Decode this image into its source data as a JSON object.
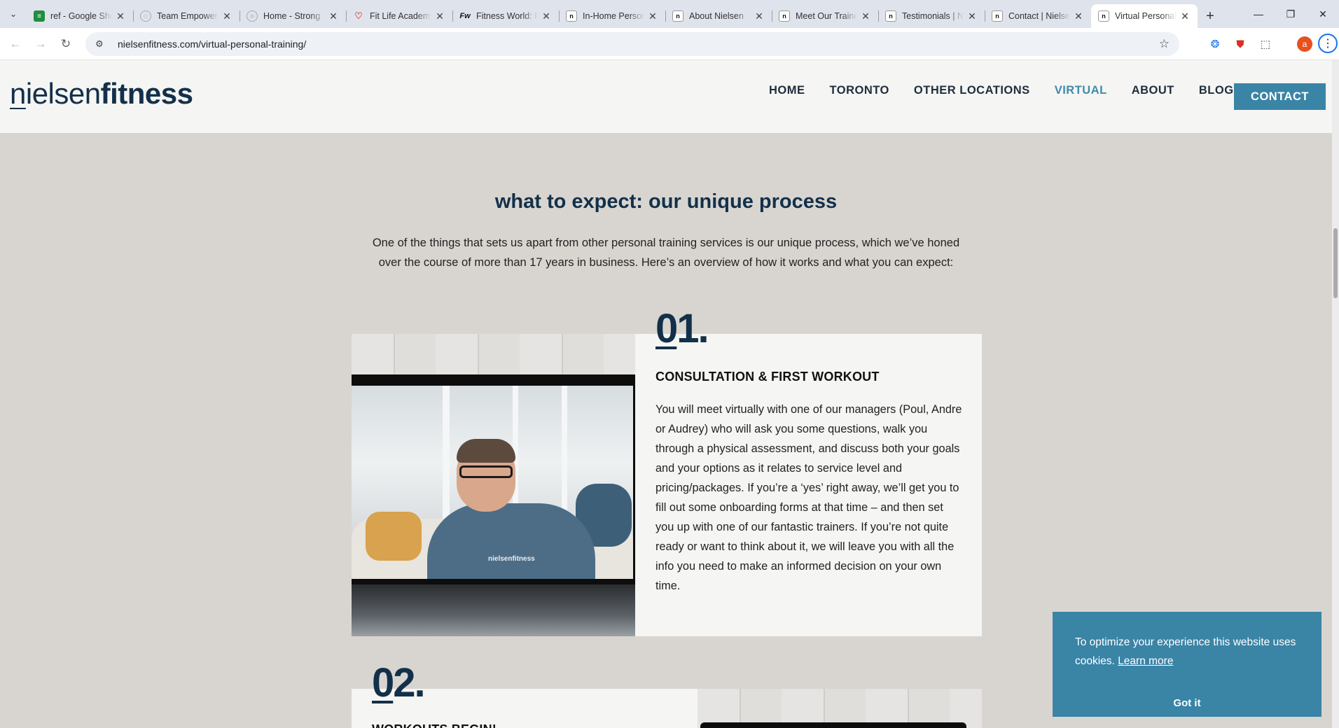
{
  "browser": {
    "tabs": [
      {
        "title": "ref - Google Sheets",
        "favicon": "sheets-icon"
      },
      {
        "title": "Team Empowerment",
        "favicon": "spiral-icon"
      },
      {
        "title": "Home - Strong",
        "favicon": "globe-icon"
      },
      {
        "title": "Fit Life Academy",
        "favicon": "heart-icon"
      },
      {
        "title": "Fitness World: Fitness",
        "favicon": "fw-icon"
      },
      {
        "title": "In-Home Personal",
        "favicon": "n-icon"
      },
      {
        "title": "About Nielsen",
        "favicon": "n-icon"
      },
      {
        "title": "Meet Our Trainers",
        "favicon": "n-icon"
      },
      {
        "title": "Testimonials | Nielsen",
        "favicon": "n-icon"
      },
      {
        "title": "Contact | Nielsen",
        "favicon": "n-icon"
      },
      {
        "title": "Virtual Personal Training",
        "favicon": "n-icon"
      }
    ],
    "active_tab_index": 10,
    "url": "nielsenfitness.com/virtual-personal-training/",
    "avatar_letter": "a"
  },
  "site": {
    "logo": {
      "part1": "n",
      "part2": "ielsen",
      "part3": "fitness"
    },
    "nav": {
      "home": "HOME",
      "toronto": "TORONTO",
      "other_locations": "OTHER LOCATIONS",
      "virtual": "VIRTUAL",
      "about": "ABOUT",
      "blog": "BLOG",
      "contact": "CONTACT"
    },
    "active_nav": "VIRTUAL",
    "accent_color": "#3a84a6",
    "brand_color": "#13304a"
  },
  "process": {
    "title": "what to expect: our unique process",
    "intro": "One of the things that sets us apart from other personal training services is our unique process, which we’ve honed over the course of more than 17 years in business. Here’s an overview of how it works and what you can expect:",
    "step1": {
      "number_a": "0",
      "number_b": "1.",
      "heading": "CONSULTATION & FIRST WORKOUT",
      "body": "You will meet virtually with one of our managers (Poul, Andre or Audrey) who will ask you some questions, walk you through a physical assessment, and discuss both your goals and your options as it relates to service level and pricing/packages. If you’re a ‘yes’ right away, we’ll get you to fill out some onboarding forms at that time – and then set you up with one of our fantastic trainers. If you’re not quite ready or want to think about it, we will leave you with all the info you need to make an informed decision on your own time.",
      "shirt_text": "nielsenfitness"
    },
    "step2": {
      "number_a": "0",
      "number_b": "2.",
      "heading": "WORKOUTS BEGIN!"
    }
  },
  "cookie_banner": {
    "message": "To optimize your experience this website uses cookies.",
    "learn_more": "Learn more",
    "accept": "Got it"
  }
}
